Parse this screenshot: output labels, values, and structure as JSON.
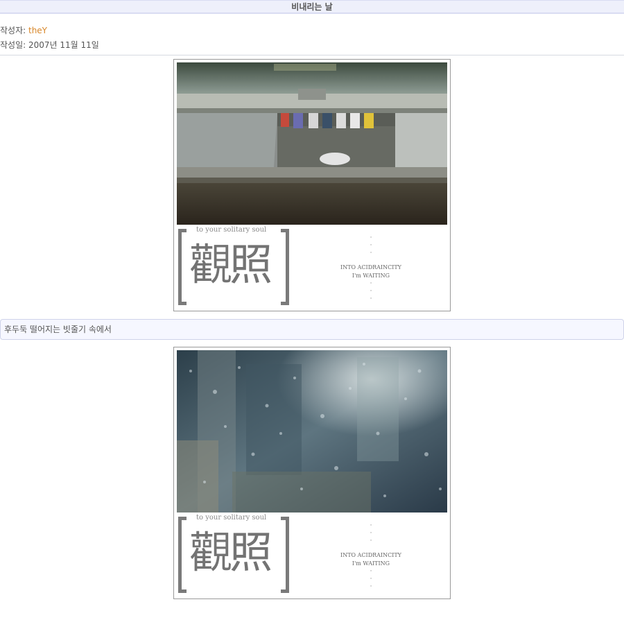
{
  "post": {
    "title": "비내리는 날",
    "author_label": "작성자: ",
    "author_name": "theY",
    "date": "작성일: 2007년 11월 11일"
  },
  "images": [
    {
      "tagline": "to your solitary soul",
      "kanji": "觀照",
      "line1": "INTO ACIDRAINCITY",
      "line2": "I'm WAITING"
    },
    {
      "tagline": "to your solitary soul",
      "kanji": "觀照",
      "line1": "INTO ACIDRAINCITY",
      "line2": "I'm WAITING"
    }
  ],
  "caption": "후두둑 떨어지는 빗줄기 속에서",
  "colors": {
    "author": "#d8872a",
    "title_bar_bg": "#eef0fb",
    "caption_bg": "#f6f7ff"
  }
}
